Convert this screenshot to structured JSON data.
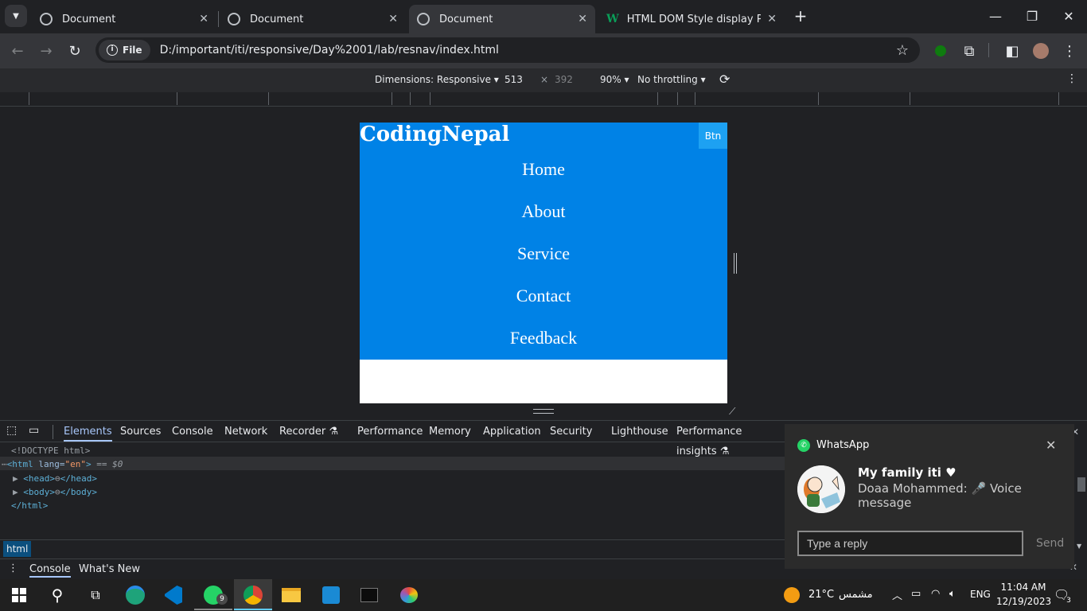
{
  "browser": {
    "tabs": [
      {
        "title": "Document",
        "active": false
      },
      {
        "title": "Document",
        "active": false
      },
      {
        "title": "Document",
        "active": true
      },
      {
        "title": "HTML DOM Style display Prope",
        "active": false
      }
    ],
    "address": {
      "chip": "File",
      "url": "D:/important/iti/responsive/Day%2001/lab/resnav/index.html"
    }
  },
  "devicebar": {
    "dimensions": "Dimensions: Responsive",
    "width": "513",
    "height": "392",
    "times": "×",
    "zoom": "90%",
    "throttling": "No throttling"
  },
  "page": {
    "logo": "CodingNepal",
    "button": "Btn",
    "nav_items": [
      "Home",
      "About",
      "Service",
      "Contact",
      "Feedback"
    ],
    "colors": {
      "nav_bg": "#0082e6",
      "button_bg": "#1da1f2"
    }
  },
  "devtools": {
    "tabs": [
      "Elements",
      "Sources",
      "Console",
      "Network",
      "Recorder",
      "Performance",
      "Memory",
      "Application",
      "Security",
      "Lighthouse",
      "Performance insights"
    ],
    "active_tab": "Elements",
    "dom": {
      "doctype": "<!DOCTYPE html>",
      "html_open": "<html",
      "lang_attr": "lang=",
      "lang_val": "\"en\"",
      "html_close_bracket": ">",
      "selected_marker": "== $0",
      "head": "<head>",
      "head_close": "</head>",
      "body": "<body>",
      "body_close": "</body>",
      "html_end": "</html>"
    },
    "breadcrumb": "html",
    "drawer_tabs": [
      "Console",
      "What's New"
    ]
  },
  "notification": {
    "app": "WhatsApp",
    "title": "My family iti ♥",
    "sender": "Doaa Mohammed:",
    "message": "🎤 Voice message",
    "reply_placeholder": "Type a reply",
    "send": "Send"
  },
  "taskbar": {
    "whatsapp_badge": "9",
    "weather_temp": "21°C",
    "weather_text": "مشمس",
    "language": "ENG",
    "time": "11:04 AM",
    "date": "12/19/2023",
    "notification_count": "3"
  }
}
